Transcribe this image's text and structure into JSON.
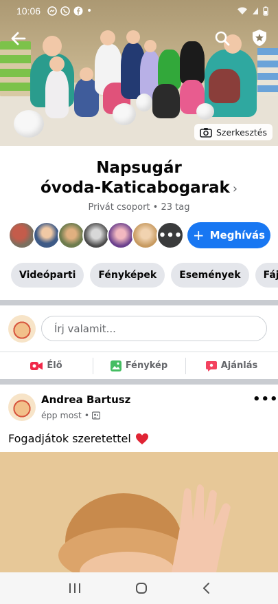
{
  "status_bar": {
    "time": "10:06"
  },
  "cover": {
    "edit_label": "Szerkesztés"
  },
  "group": {
    "name_line1": "Napsugár",
    "name_line2": "óvoda-Katicabogarak",
    "chevron": "›",
    "privacy": "Privát csoport",
    "separator": " • ",
    "members": "23 tag",
    "more_members": "•••",
    "invite_icon": "+",
    "invite_label": "Meghívás"
  },
  "chips": [
    "Videóparti",
    "Fényképek",
    "Események",
    "Fájlok"
  ],
  "composer": {
    "placeholder": "Írj valamit...",
    "actions": [
      {
        "label": "Élő",
        "icon": "live-video-icon"
      },
      {
        "label": "Fénykép",
        "icon": "photo-icon"
      },
      {
        "label": "Ajánlás",
        "icon": "recommendation-icon"
      }
    ]
  },
  "post": {
    "author": "Andrea Bartusz",
    "time": "épp most",
    "meta_separator": "•",
    "text": "Fogadjátok szeretettel",
    "heart": "❤️",
    "more": "•••"
  },
  "colors": {
    "accent": "#1877f2",
    "chip_bg": "#e4e6eb",
    "divider": "#c9ccd1",
    "live": "#f02849",
    "photo": "#45bd62",
    "recommend": "#f3425f"
  }
}
